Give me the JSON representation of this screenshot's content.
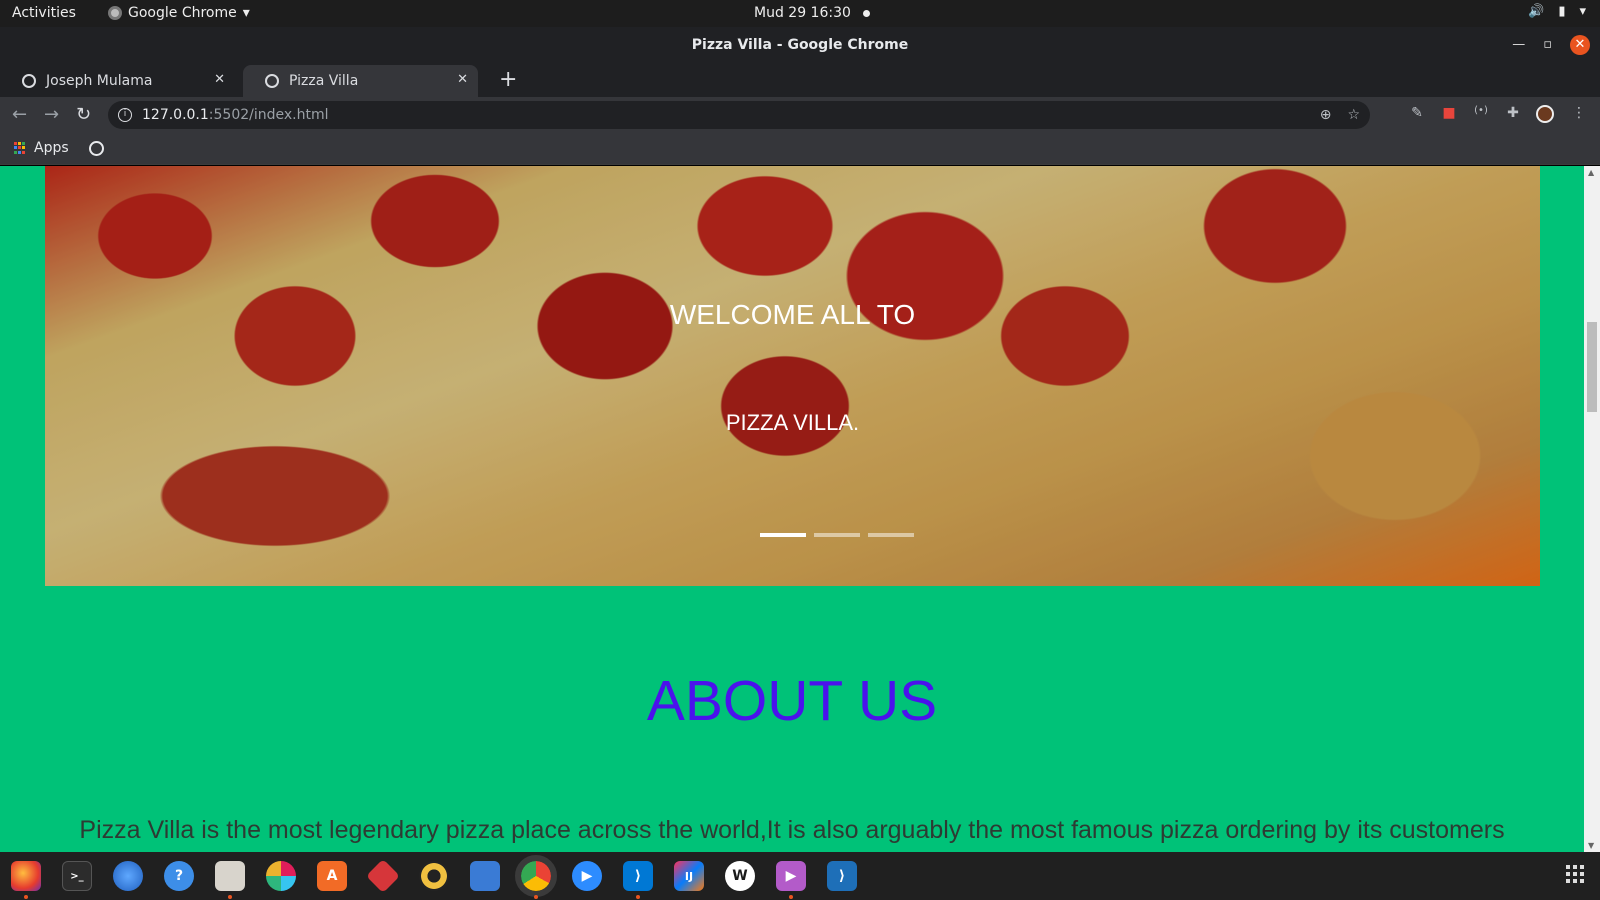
{
  "topbar": {
    "activities": "Activities",
    "app_name": "Google Chrome",
    "clock": "Mud 29  16:30"
  },
  "window": {
    "title": "Pizza Villa - Google Chrome"
  },
  "tabs": [
    {
      "label": "Joseph Mulama",
      "active": false
    },
    {
      "label": "Pizza Villa",
      "active": true
    }
  ],
  "omnibox": {
    "host": "127.0.0.1",
    "path": ":5502/index.html"
  },
  "bookmarks": {
    "apps_label": "Apps"
  },
  "page": {
    "hero": {
      "line1": "WELCOME ALL TO",
      "line2": "PIZZA VILLA.",
      "slide_count": 3,
      "active_slide": 1
    },
    "about": {
      "title": "ABOUT US",
      "text": "Pizza Villa is the most legendary pizza place across the world,It is also arguably the most famous pizza ordering by its customers"
    }
  },
  "colors": {
    "page_background": "#00c278",
    "about_title": "#4b12ec",
    "accent_ubuntu": "#e95420"
  },
  "dock": {
    "apps": [
      "firefox-icon",
      "terminal-icon",
      "thunderbird-icon",
      "help-icon",
      "files-icon",
      "slack-icon",
      "software-center-icon",
      "git-icon",
      "rhythmbox-icon",
      "text-editor-icon",
      "chrome-icon",
      "zoom-icon",
      "vscode-icon",
      "intellij-icon",
      "libreoffice-writer-icon",
      "video-player-icon",
      "vscode-insiders-icon"
    ]
  }
}
